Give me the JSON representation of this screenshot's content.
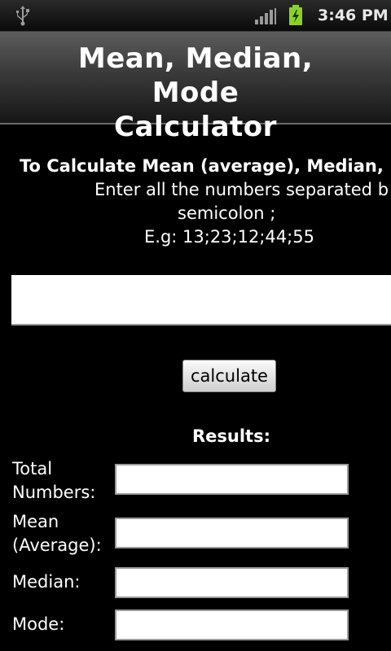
{
  "status_bar": {
    "time": "3:46 PM",
    "icons": [
      "usb-icon",
      "signal-icon",
      "battery-charging-icon"
    ]
  },
  "app": {
    "title_line1": "Mean, Median, Mode",
    "title_line2": "Calculator"
  },
  "instructions": {
    "heading": "To Calculate Mean (average), Median, M",
    "line1": "Enter all the numbers separated b",
    "line2": "semicolon ;",
    "example": "E.g: 13;23;12;44;55"
  },
  "numbers_input": {
    "value": "",
    "placeholder": ""
  },
  "calculate_button": {
    "label": "calculate"
  },
  "results": {
    "heading": "Results:",
    "total": {
      "label_line1": "Total",
      "label_line2": "Numbers:",
      "value": ""
    },
    "mean": {
      "label_line1": "Mean",
      "label_line2": "(Average):",
      "value": ""
    },
    "median": {
      "label": "Median:",
      "value": ""
    },
    "mode": {
      "label": "Mode:",
      "value": ""
    }
  },
  "colors": {
    "background": "#000000",
    "text": "#ffffff",
    "title_bar_top": "#5c5c5c",
    "title_bar_bottom": "#161616",
    "battery_charging": "#8bd12a"
  }
}
